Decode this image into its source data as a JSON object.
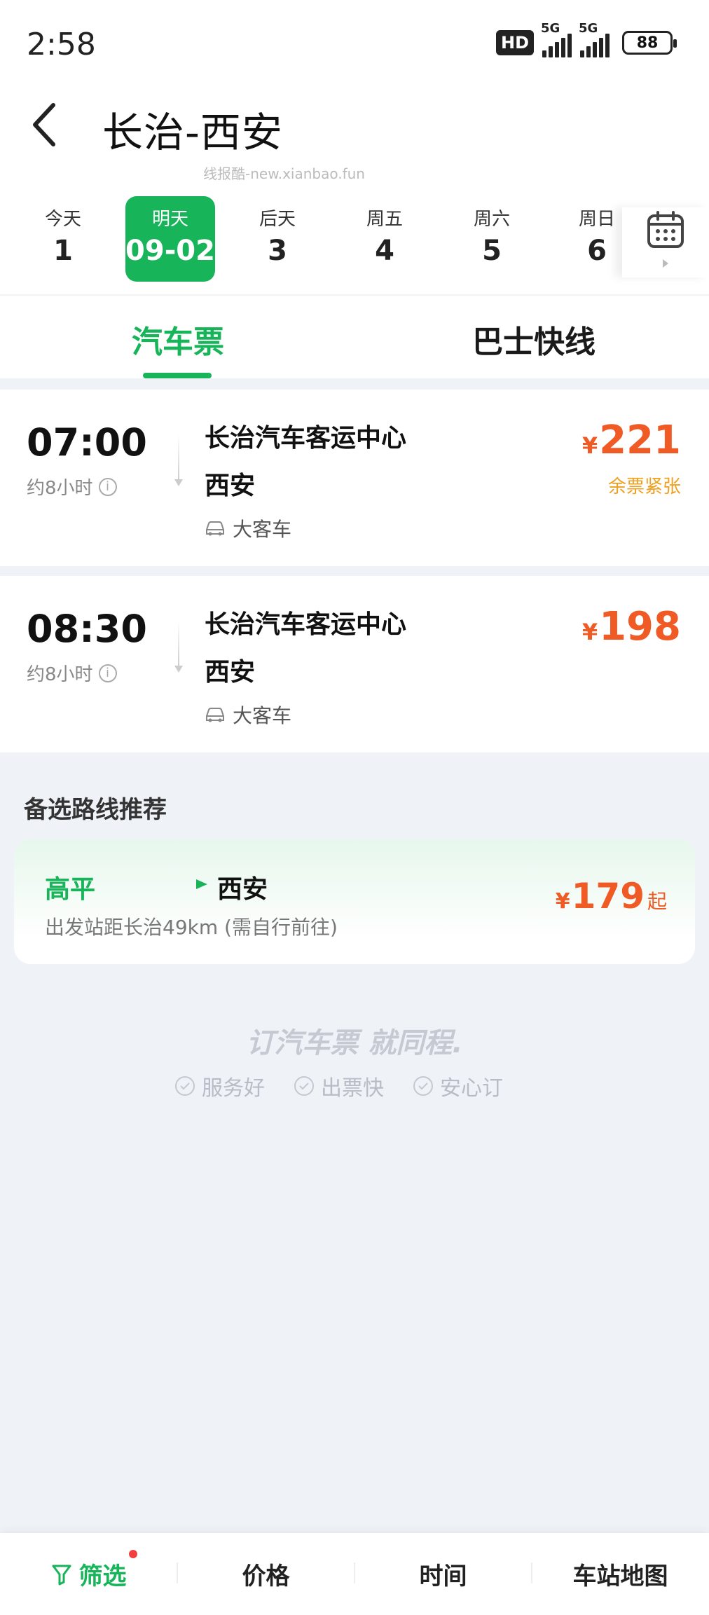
{
  "status_bar": {
    "time": "2:58",
    "hd": "HD",
    "network1": "5G",
    "network2": "5G",
    "battery": "88"
  },
  "header": {
    "title": "长治-西安",
    "watermark": "线报酷-new.xianbao.fun"
  },
  "dates": [
    {
      "label": "今天",
      "value": "1",
      "selected": false
    },
    {
      "label": "明天",
      "value": "09-02",
      "selected": true
    },
    {
      "label": "后天",
      "value": "3",
      "selected": false
    },
    {
      "label": "周五",
      "value": "4",
      "selected": false
    },
    {
      "label": "周六",
      "value": "5",
      "selected": false
    },
    {
      "label": "周日",
      "value": "6",
      "selected": false
    }
  ],
  "tabs": [
    {
      "label": "汽车票",
      "active": true
    },
    {
      "label": "巴士快线",
      "active": false
    }
  ],
  "trips": [
    {
      "time": "07:00",
      "duration": "约8小时",
      "from": "长治汽车客运中心",
      "to": "西安",
      "vehicle": "大客车",
      "currency": "¥",
      "price": "221",
      "badge": "余票紧张"
    },
    {
      "time": "08:30",
      "duration": "约8小时",
      "from": "长治汽车客运中心",
      "to": "西安",
      "vehicle": "大客车",
      "currency": "¥",
      "price": "198",
      "badge": ""
    }
  ],
  "alternative": {
    "title": "备选路线推荐",
    "from": "高平",
    "to": "西安",
    "note": "出发站距长治49km (需自行前往)",
    "currency": "¥",
    "price": "179",
    "suffix": "起"
  },
  "slogan": {
    "text": "订汽车票 就同程.",
    "features": [
      "服务好",
      "出票快",
      "安心订"
    ]
  },
  "bottom_bar": {
    "filter": "筛选",
    "price": "价格",
    "time": "时间",
    "map": "车站地图"
  },
  "colors": {
    "brand_green": "#17b45a",
    "price_orange": "#f05a24",
    "warning_amber": "#f0a020"
  }
}
